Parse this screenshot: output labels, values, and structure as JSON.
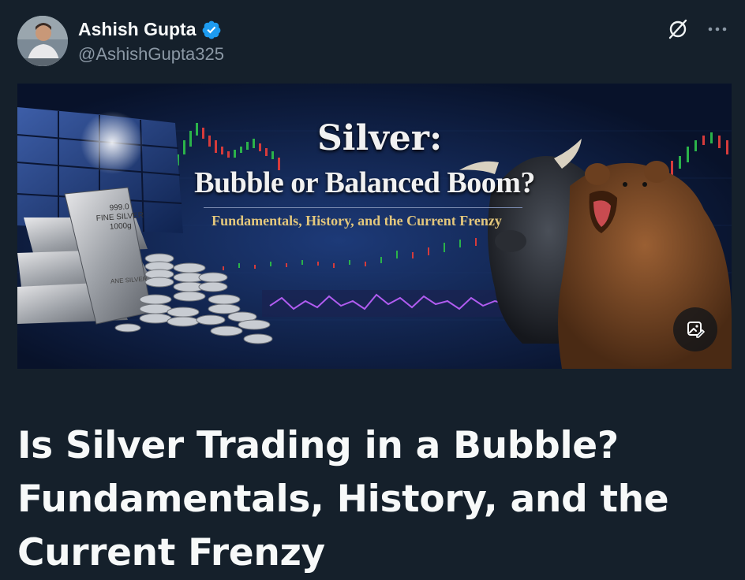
{
  "author": {
    "name": "Ashish Gupta",
    "handle": "@AshishGupta325",
    "verified": true,
    "verified_color": "#1d9bf0"
  },
  "header_actions": {
    "grok_icon": "grok-icon",
    "more_icon": "more-icon"
  },
  "cover_image": {
    "title_line1": "Silver:",
    "title_line2": "Bubble or Balanced Boom?",
    "tagline": "Fundamentals, History, and the Current Frenzy",
    "bar_label": "999.0\nFINE SILVER\n1000g",
    "bar_mark": "ANE SILVER",
    "media_icon": "image-edit-icon"
  },
  "article": {
    "title": "Is Silver Trading in a Bubble? Fundamentals, History, and the Current Frenzy"
  },
  "colors": {
    "background": "#15202b",
    "text_primary": "#f7f9f9",
    "text_secondary": "#8b98a5",
    "accent": "#1d9bf0"
  }
}
